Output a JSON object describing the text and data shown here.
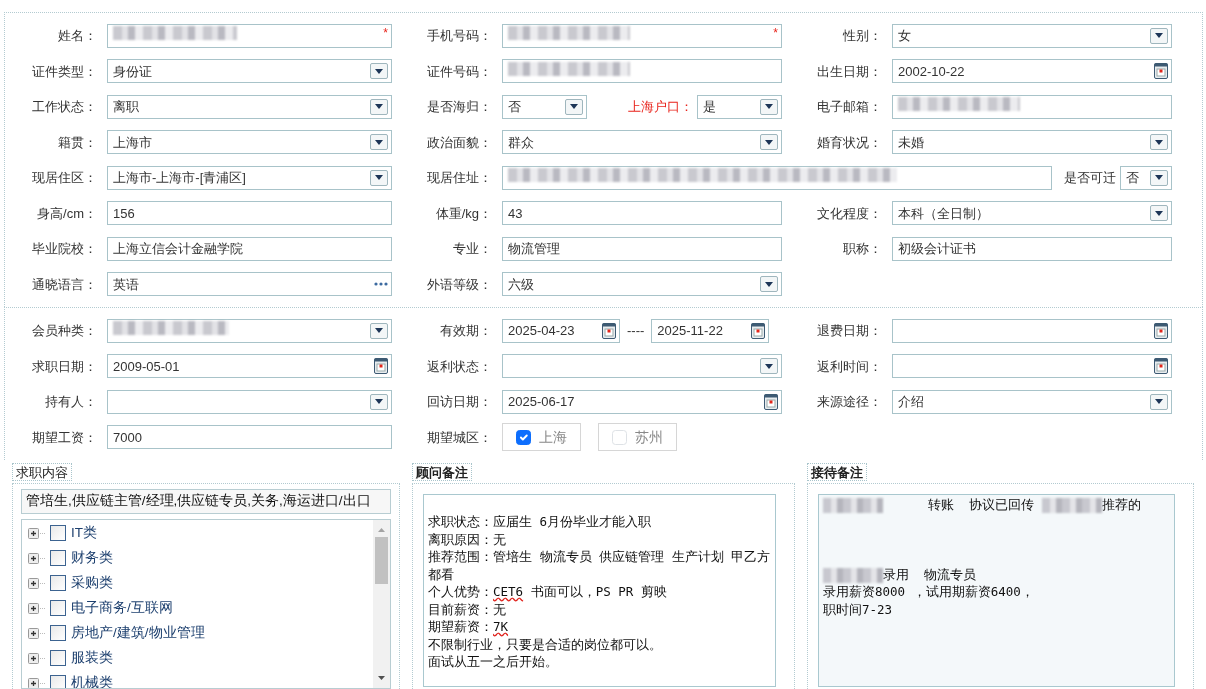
{
  "profile": {
    "rows": [
      {
        "kind": "triple",
        "cells": [
          [
            {
              "label": "姓名：",
              "kind": "text",
              "redacted": true,
              "required_mark": "*"
            }
          ],
          [
            {
              "label": "手机号码：",
              "kind": "text",
              "redacted": true,
              "required_mark": "*"
            }
          ],
          [
            {
              "label": "性别：",
              "kind": "select",
              "value": "女"
            }
          ]
        ]
      },
      {
        "kind": "triple",
        "cells": [
          [
            {
              "label": "证件类型：",
              "kind": "select",
              "value": "身份证"
            }
          ],
          [
            {
              "label": "证件号码：",
              "kind": "text",
              "redacted": true
            }
          ],
          [
            {
              "label": "出生日期：",
              "kind": "date",
              "value": "2002-10-22"
            }
          ]
        ]
      },
      {
        "kind": "triple",
        "cells": [
          [
            {
              "label": "工作状态：",
              "kind": "select",
              "value": "离职"
            }
          ],
          [
            {
              "label": "是否海归：",
              "kind": "short-select",
              "value": "否"
            },
            {
              "label": "上海户口：",
              "kind": "short-select",
              "value": "是",
              "highlighted": true
            }
          ],
          [
            {
              "label": "电子邮箱：",
              "kind": "text",
              "redacted": true
            }
          ]
        ]
      },
      {
        "kind": "triple",
        "cells": [
          [
            {
              "label": "籍贯：",
              "kind": "select",
              "value": "上海市"
            }
          ],
          [
            {
              "label": "政治面貌：",
              "kind": "select",
              "value": "群众"
            }
          ],
          [
            {
              "label": "婚育状况：",
              "kind": "select",
              "value": "未婚"
            }
          ]
        ]
      },
      {
        "kind": "address",
        "cells": [
          [
            {
              "label": "现居住区：",
              "kind": "select",
              "value": "上海市-上海市-[青浦区]"
            }
          ],
          [
            {
              "label": "现居住址：",
              "kind": "text",
              "redacted": true
            },
            {
              "label": "是否可迁",
              "kind": "tiny-select",
              "value": "否"
            }
          ]
        ]
      },
      {
        "kind": "triple",
        "cells": [
          [
            {
              "label": "身高/cm：",
              "kind": "text",
              "value": "156"
            }
          ],
          [
            {
              "label": "体重/kg：",
              "kind": "text",
              "value": "43"
            }
          ],
          [
            {
              "label": "文化程度：",
              "kind": "select",
              "value": "本科（全日制）"
            }
          ]
        ]
      },
      {
        "kind": "triple",
        "cells": [
          [
            {
              "label": "毕业院校：",
              "kind": "text",
              "value": "上海立信会计金融学院"
            }
          ],
          [
            {
              "label": "专业：",
              "kind": "text",
              "value": "物流管理"
            }
          ],
          [
            {
              "label": "职称：",
              "kind": "text",
              "value": "初级会计证书"
            }
          ]
        ]
      },
      {
        "kind": "triple",
        "cells": [
          [
            {
              "label": "通晓语言：",
              "kind": "lookup",
              "value": "英语"
            }
          ],
          [
            {
              "label": "外语等级：",
              "kind": "select",
              "value": "六级"
            }
          ]
        ]
      }
    ]
  },
  "membership": {
    "rows": [
      {
        "kind": "triple",
        "cells": [
          [
            {
              "label": "会员种类：",
              "kind": "select",
              "redacted": true
            }
          ],
          [
            {
              "label": "有效期：",
              "kind": "date-range",
              "values": [
                "2025-04-23",
                "2025-11-22"
              ],
              "separator": "----"
            }
          ],
          [
            {
              "label": "退费日期：",
              "kind": "date"
            }
          ]
        ]
      },
      {
        "kind": "triple",
        "cells": [
          [
            {
              "label": "求职日期：",
              "kind": "date",
              "value": "2009-05-01"
            }
          ],
          [
            {
              "label": "返利状态：",
              "kind": "select"
            }
          ],
          [
            {
              "label": "返利时间：",
              "kind": "date"
            }
          ]
        ]
      },
      {
        "kind": "triple",
        "cells": [
          [
            {
              "label": "持有人：",
              "kind": "select"
            }
          ],
          [
            {
              "label": "回访日期：",
              "kind": "date",
              "value": "2025-06-17"
            }
          ],
          [
            {
              "label": "来源途径：",
              "kind": "select",
              "value": "介绍"
            }
          ]
        ]
      },
      {
        "kind": "triple",
        "cells": [
          [
            {
              "label": "期望工资：",
              "kind": "text",
              "value": "7000"
            }
          ],
          [
            {
              "label": "期望城区：",
              "kind": "checkbox-group",
              "options": [
                {
                  "label": "上海",
                  "checked": true
                },
                {
                  "label": "苏州",
                  "checked": false
                }
              ]
            }
          ]
        ]
      }
    ]
  },
  "panels": [
    {
      "kind": "job-tree",
      "legend": "求职内容",
      "summary": "管培生,供应链主管/经理,供应链专员,关务,海运进口/出口",
      "tree": [
        {
          "label": "IT类",
          "checked": false,
          "expanded": false
        },
        {
          "label": "财务类",
          "checked": false,
          "expanded": false
        },
        {
          "label": "采购类",
          "checked": false,
          "expanded": false
        },
        {
          "label": "电子商务/互联网",
          "checked": false,
          "expanded": false
        },
        {
          "label": "房地产/建筑/物业管理",
          "checked": false,
          "expanded": false
        },
        {
          "label": "服装类",
          "checked": false,
          "expanded": false
        },
        {
          "label": "机械类",
          "checked": false,
          "expanded": false
        }
      ]
    },
    {
      "kind": "note",
      "legend": "顾问备注",
      "lines": [
        {
          "kind": "blank"
        },
        {
          "kind": "text",
          "segments": [
            {
              "text": "求职状态：应届生 6月份毕业才能入职"
            }
          ]
        },
        {
          "kind": "text",
          "segments": [
            {
              "text": "离职原因：无"
            }
          ]
        },
        {
          "kind": "text",
          "segments": [
            {
              "text": "推荐范围：管培生 物流专员 供应链管理 生产计划 甲乙方都看"
            }
          ]
        },
        {
          "kind": "text",
          "segments": [
            {
              "text": "个人优势："
            },
            {
              "text": "CET6",
              "flagged": true
            },
            {
              "text": " 书面可以，PS PR 剪映"
            }
          ]
        },
        {
          "kind": "text",
          "segments": [
            {
              "text": "目前薪资：无"
            }
          ]
        },
        {
          "kind": "text",
          "segments": [
            {
              "text": "期望薪资："
            },
            {
              "text": "7K",
              "flagged": true
            }
          ]
        },
        {
          "kind": "text",
          "segments": [
            {
              "text": "不限制行业，只要是合适的岗位都可以。"
            }
          ]
        },
        {
          "kind": "text",
          "segments": [
            {
              "text": "面试从五一之后开始。"
            }
          ]
        }
      ]
    },
    {
      "kind": "note",
      "legend": "接待备注",
      "lines": [
        {
          "kind": "text",
          "segments": [
            {
              "redacted": true
            },
            {
              "text": "      转账  协议已回传 "
            },
            {
              "redacted": true
            },
            {
              "text": "推荐的"
            }
          ]
        },
        {
          "kind": "blank"
        },
        {
          "kind": "blank"
        },
        {
          "kind": "blank"
        },
        {
          "kind": "text",
          "segments": [
            {
              "redacted": true
            },
            {
              "text": "录用  物流专员"
            }
          ]
        },
        {
          "kind": "text",
          "segments": [
            {
              "text": "录用薪资8000 ，试用期薪资6400，"
            }
          ]
        },
        {
          "kind": "text",
          "segments": [
            {
              "text": "职时间7-23"
            }
          ]
        }
      ]
    }
  ]
}
